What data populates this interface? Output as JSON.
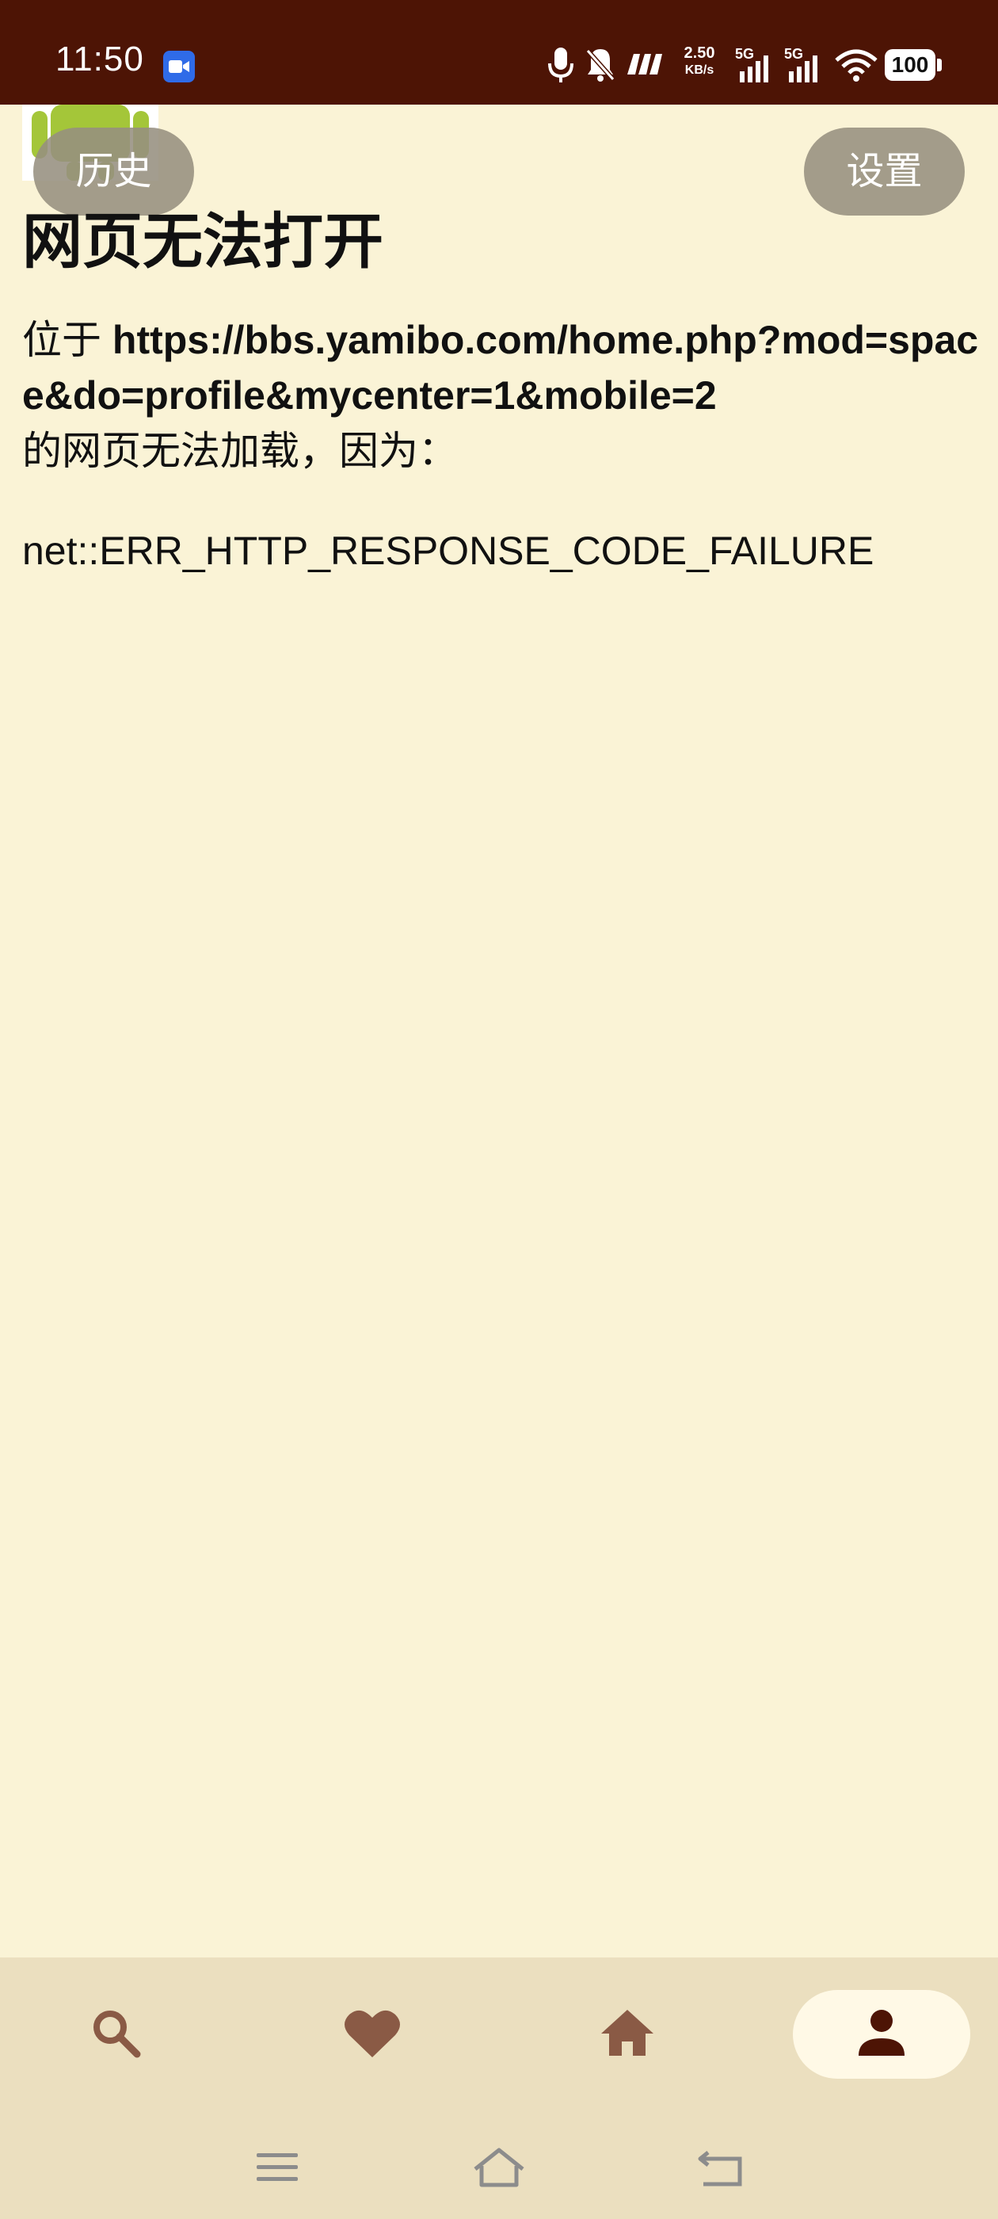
{
  "status_bar": {
    "time": "11:50",
    "net_speed_value": "2.50",
    "net_speed_unit": "KB/s",
    "sim1_label": "5G",
    "sim2_label": "5G",
    "battery": "100"
  },
  "buttons": {
    "history": "历史",
    "settings": "设置"
  },
  "error_page": {
    "title": "网页无法打开",
    "prefix": "位于 ",
    "url": "https://bbs.yamibo.com/home.php?mod=space&do=profile&mycenter=1&mobile=2",
    "suffix": "的网页无法加载，因为：",
    "code": "net::ERR_HTTP_RESPONSE_CODE_FAILURE"
  },
  "bottom_nav": {
    "items": [
      "search-icon",
      "heart-icon",
      "home-icon",
      "person-icon"
    ],
    "active_index": 3,
    "icon_color": "#8A5A45",
    "active_icon_color": "#4D1405"
  },
  "colors": {
    "status_bar_bg": "#4D1405",
    "page_bg": "#FAF3D6",
    "nav_bg": "#EBDFBF",
    "pill_bg": "#969080"
  }
}
